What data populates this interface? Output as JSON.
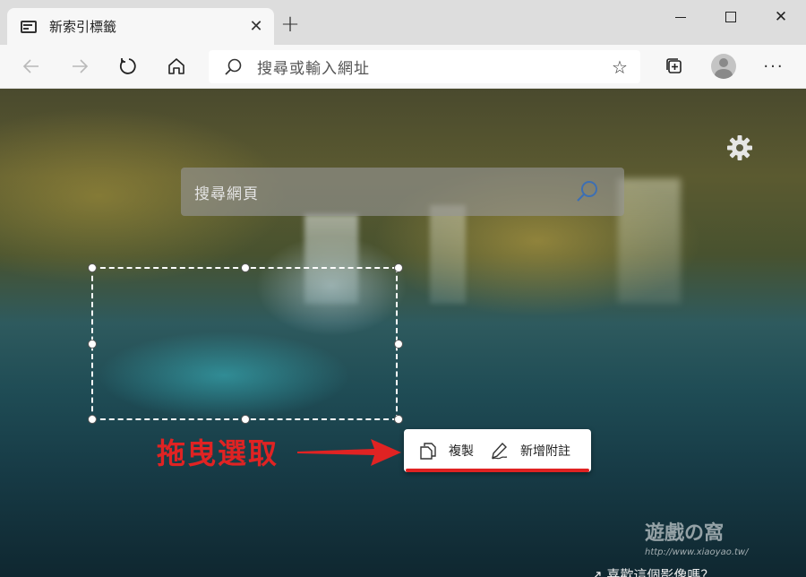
{
  "tab": {
    "title": "新索引標籤",
    "close_glyph": "✕"
  },
  "newtab": {
    "glyph": "+"
  },
  "window": {
    "close_glyph": "✕"
  },
  "toolbar": {
    "address_placeholder": "搜尋或輸入網址",
    "star_glyph": "☆",
    "more_glyph": "···"
  },
  "page": {
    "search_placeholder": "搜尋網頁",
    "annotation": "拖曳選取",
    "watermark": "遊戲の窩",
    "watermark_url": "http://www.xiaoyao.tw/",
    "like_prompt": "↗ 喜歡這個影像嗎？"
  },
  "popup": {
    "copy_label": "複製",
    "note_label": "新增附註"
  },
  "colors": {
    "annotation_red": "#e02323",
    "toolbar_bg": "#f7f7f7",
    "tabstrip_bg": "#dddddd"
  }
}
